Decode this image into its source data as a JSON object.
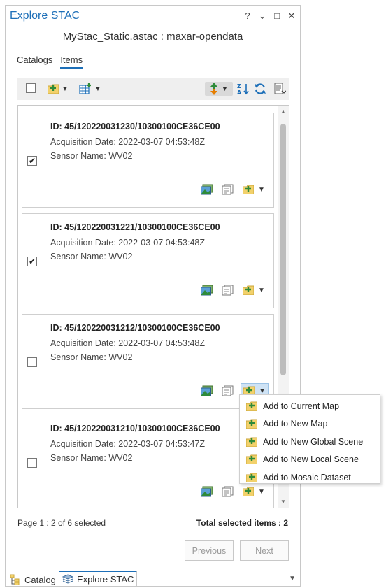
{
  "window": {
    "title": "Explore STAC",
    "btn_help": "?",
    "btn_menu": "⌄",
    "btn_max": "□",
    "btn_close": "✕"
  },
  "subtitle": "MyStac_Static.astac : maxar-opendata",
  "tabs": [
    {
      "label": "Catalogs",
      "active": false
    },
    {
      "label": "Items",
      "active": true
    }
  ],
  "items": [
    {
      "id": "ID: 45/120220031230/10300100CE36CE00",
      "acq": "Acquisition Date: 2022-03-07 04:53:48Z",
      "sensor": "Sensor Name: WV02",
      "checked": "✔"
    },
    {
      "id": "ID: 45/120220031221/10300100CE36CE00",
      "acq": "Acquisition Date: 2022-03-07 04:53:48Z",
      "sensor": "Sensor Name: WV02",
      "checked": "✔"
    },
    {
      "id": "ID: 45/120220031212/10300100CE36CE00",
      "acq": "Acquisition Date: 2022-03-07 04:53:48Z",
      "sensor": "Sensor Name: WV02",
      "checked": ""
    },
    {
      "id": "ID: 45/120220031210/10300100CE36CE00",
      "acq": "Acquisition Date: 2022-03-07 04:53:47Z",
      "sensor": "Sensor Name: WV02",
      "checked": ""
    }
  ],
  "menu": [
    "Add to Current  Map",
    "Add to New Map",
    "Add to New Global Scene",
    "Add to New Local Scene",
    "Add to Mosaic Dataset"
  ],
  "footer": {
    "page": "Page 1 : 2 of 6 selected",
    "total": "Total selected items : 2",
    "previous": "Previous",
    "next": "Next"
  },
  "bottom_tabs": [
    {
      "label": "Catalog",
      "icon": "catalog-icon",
      "active": false
    },
    {
      "label": "Explore STAC",
      "icon": "explore-stac-icon",
      "active": true
    }
  ],
  "colors": {
    "accent": "#1d6fb8",
    "folder": "#f2d16b",
    "add": "#2e8b3a",
    "menu_highlight": "#cfe3f5"
  }
}
